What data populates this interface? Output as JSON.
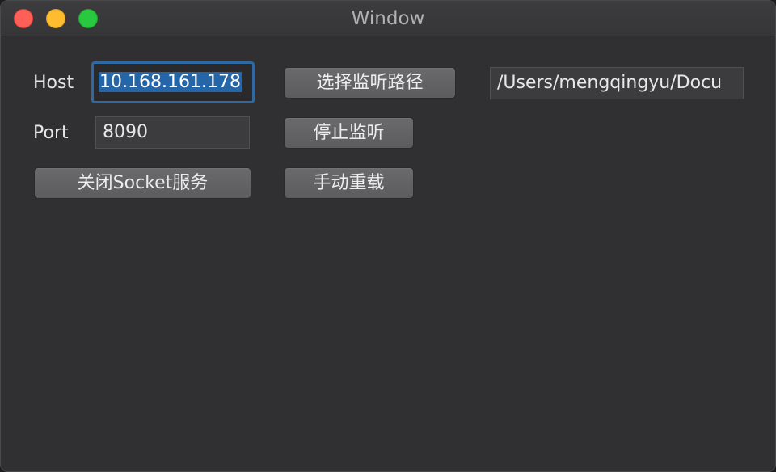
{
  "window": {
    "title": "Window"
  },
  "form": {
    "host_label": "Host",
    "host_value": "10.168.161.178",
    "port_label": "Port",
    "port_value": "8090",
    "path_value": "/Users/mengqingyu/Docu"
  },
  "buttons": {
    "choose_path": "选择监听路径",
    "stop_listen": "停止监听",
    "close_socket": "关闭Socket服务",
    "manual_reload": "手动重载"
  },
  "colors": {
    "window_bg": "#303033",
    "focus_ring": "#2e6aa1",
    "selection": "#2566a8",
    "close": "#fe5f57",
    "minimize": "#febc2e",
    "zoom": "#28c840"
  }
}
